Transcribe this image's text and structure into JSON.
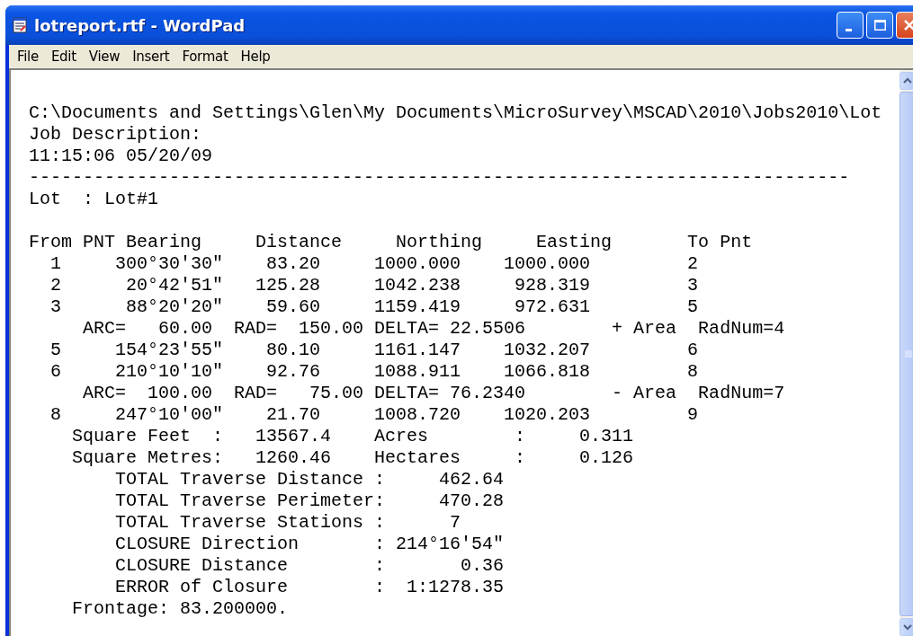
{
  "window": {
    "title": "lotreport.rtf - WordPad"
  },
  "menu": [
    "File",
    "Edit",
    "View",
    "Insert",
    "Format",
    "Help"
  ],
  "document": {
    "blocks": [
      {
        "lines": [
          "C:\\Documents and Settings\\Glen\\My Documents\\MicroSurvey\\MSCAD\\2010\\Jobs2010\\Lot",
          "Job Description:",
          "11:15:06 05/20/09",
          "----------------------------------------------------------------------------",
          "Lot  : Lot#1"
        ]
      },
      {
        "lines": [
          "From PNT Bearing     Distance     Northing     Easting       To Pnt",
          "  1     300°30'30\"    83.20     1000.000    1000.000         2",
          "  2      20°42'51\"   125.28     1042.238     928.319         3",
          "  3      88°20'20\"    59.60     1159.419     972.631         5",
          "     ARC=   60.00  RAD=  150.00 DELTA= 22.5506        + Area  RadNum=4",
          "  5     154°23'55\"    80.10     1161.147    1032.207         6",
          "  6     210°10'10\"    92.76     1088.911    1066.818         8",
          "     ARC=  100.00  RAD=   75.00 DELTA= 76.2340        - Area  RadNum=7",
          "  8     247°10'00\"    21.70     1008.720    1020.203         9",
          "    Square Feet  :   13567.4    Acres        :     0.311",
          "    Square Metres:   1260.46    Hectares     :     0.126",
          "        TOTAL Traverse Distance :     462.64",
          "        TOTAL Traverse Perimeter:     470.28",
          "        TOTAL Traverse Stations :      7",
          "        CLOSURE Direction       : 214°16'54\"",
          "        CLOSURE Distance        :       0.36",
          "        ERROR of Closure        :  1:1278.35",
          "    Frontage: 83.200000."
        ]
      }
    ]
  }
}
